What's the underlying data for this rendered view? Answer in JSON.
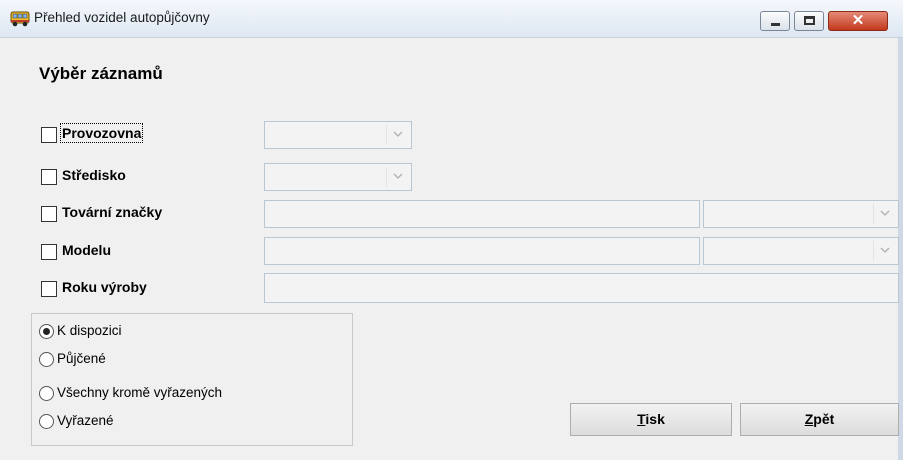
{
  "window": {
    "title": "Přehled vozidel autopůjčovny",
    "close_glyph": "✕"
  },
  "heading": "Výběr záznamů",
  "filters": [
    {
      "label": "Provozovna",
      "checked": false
    },
    {
      "label": "Středisko",
      "checked": false
    },
    {
      "label": "Tovární značky",
      "checked": false
    },
    {
      "label": "Modelu",
      "checked": false
    },
    {
      "label": "Roku výroby",
      "checked": false
    }
  ],
  "availability": {
    "options": [
      "K dispozici",
      "Půjčené",
      "Všechny kromě vyřazených",
      "Vyřazené"
    ],
    "selected": "K dispozici"
  },
  "buttons": {
    "print": {
      "first": "T",
      "rest": "isk"
    },
    "back": {
      "first": "Z",
      "rest": "pět"
    }
  },
  "icons": [
    "bus-icon",
    "minimize-icon",
    "maximize-icon",
    "close-icon",
    "chevron-down-icon"
  ]
}
